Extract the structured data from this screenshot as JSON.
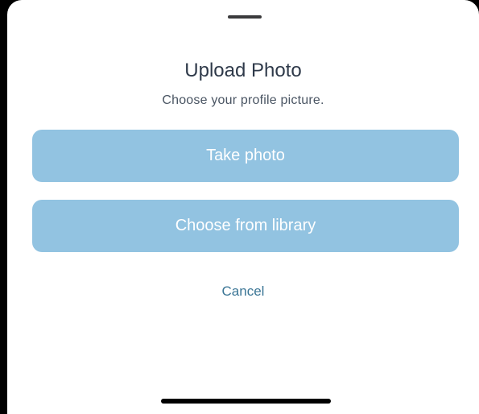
{
  "sheet": {
    "title": "Upload Photo",
    "subtitle": "Choose your profile picture.",
    "actions": [
      {
        "label": "Take photo"
      },
      {
        "label": "Choose from library"
      }
    ],
    "cancel_label": "Cancel"
  },
  "colors": {
    "button_fill": "#92c3e1",
    "button_text": "#ffffff",
    "cancel_text": "#3a7595",
    "title_text": "#2f3a4a"
  }
}
